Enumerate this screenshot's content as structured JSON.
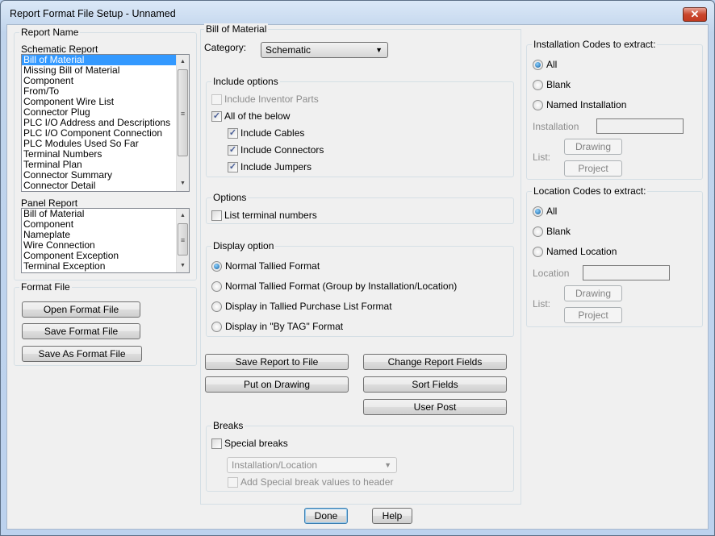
{
  "window": {
    "title": "Report Format File Setup - Unnamed",
    "close_label": "✕"
  },
  "left": {
    "report_name_label": "Report Name",
    "schematic_label": "Schematic Report",
    "schematic_items": [
      "Bill of Material",
      "Missing Bill of Material",
      "Component",
      "From/To",
      "Component Wire List",
      "Connector Plug",
      "PLC I/O Address and Descriptions",
      "PLC I/O Component Connection",
      "PLC Modules Used So Far",
      "Terminal Numbers",
      "Terminal Plan",
      "Connector Summary",
      "Connector Detail"
    ],
    "panel_label": "Panel Report",
    "panel_items": [
      "Bill of Material",
      "Component",
      "Nameplate",
      "Wire Connection",
      "Component Exception",
      "Terminal Exception"
    ],
    "format_file_label": "Format File",
    "open_btn": "Open Format File",
    "save_btn": "Save Format File",
    "save_as_btn": "Save As Format File"
  },
  "middle": {
    "section_title": "Bill of Material",
    "category_label": "Category:",
    "category_value": "Schematic",
    "include_label": "Include options",
    "inventor": "Include Inventor Parts",
    "all_below": "All of the below",
    "cables": "Include Cables",
    "connectors": "Include Connectors",
    "jumpers": "Include Jumpers",
    "options_label": "Options",
    "list_terminals": "List terminal numbers",
    "display_label": "Display option",
    "display_options": [
      "Normal Tallied Format",
      "Normal Tallied Format (Group by Installation/Location)",
      "Display in Tallied Purchase List Format",
      "Display in \"By TAG\" Format"
    ],
    "save_report": "Save Report to File",
    "change_fields": "Change Report Fields",
    "put_drawing": "Put on Drawing",
    "sort_fields": "Sort Fields",
    "user_post": "User Post",
    "breaks_label": "Breaks",
    "special_breaks": "Special breaks",
    "breaks_combo": "Installation/Location",
    "add_special": "Add Special break values to header"
  },
  "right": {
    "inst_label": "Installation Codes to extract:",
    "all": "All",
    "blank": "Blank",
    "named_inst": "Named Installation",
    "inst_field": "Installation",
    "drawing": "Drawing",
    "project": "Project",
    "list": "List:",
    "loc_label": "Location Codes to extract:",
    "named_loc": "Named Location",
    "loc_field": "Location"
  },
  "footer": {
    "done": "Done",
    "help": "Help"
  }
}
